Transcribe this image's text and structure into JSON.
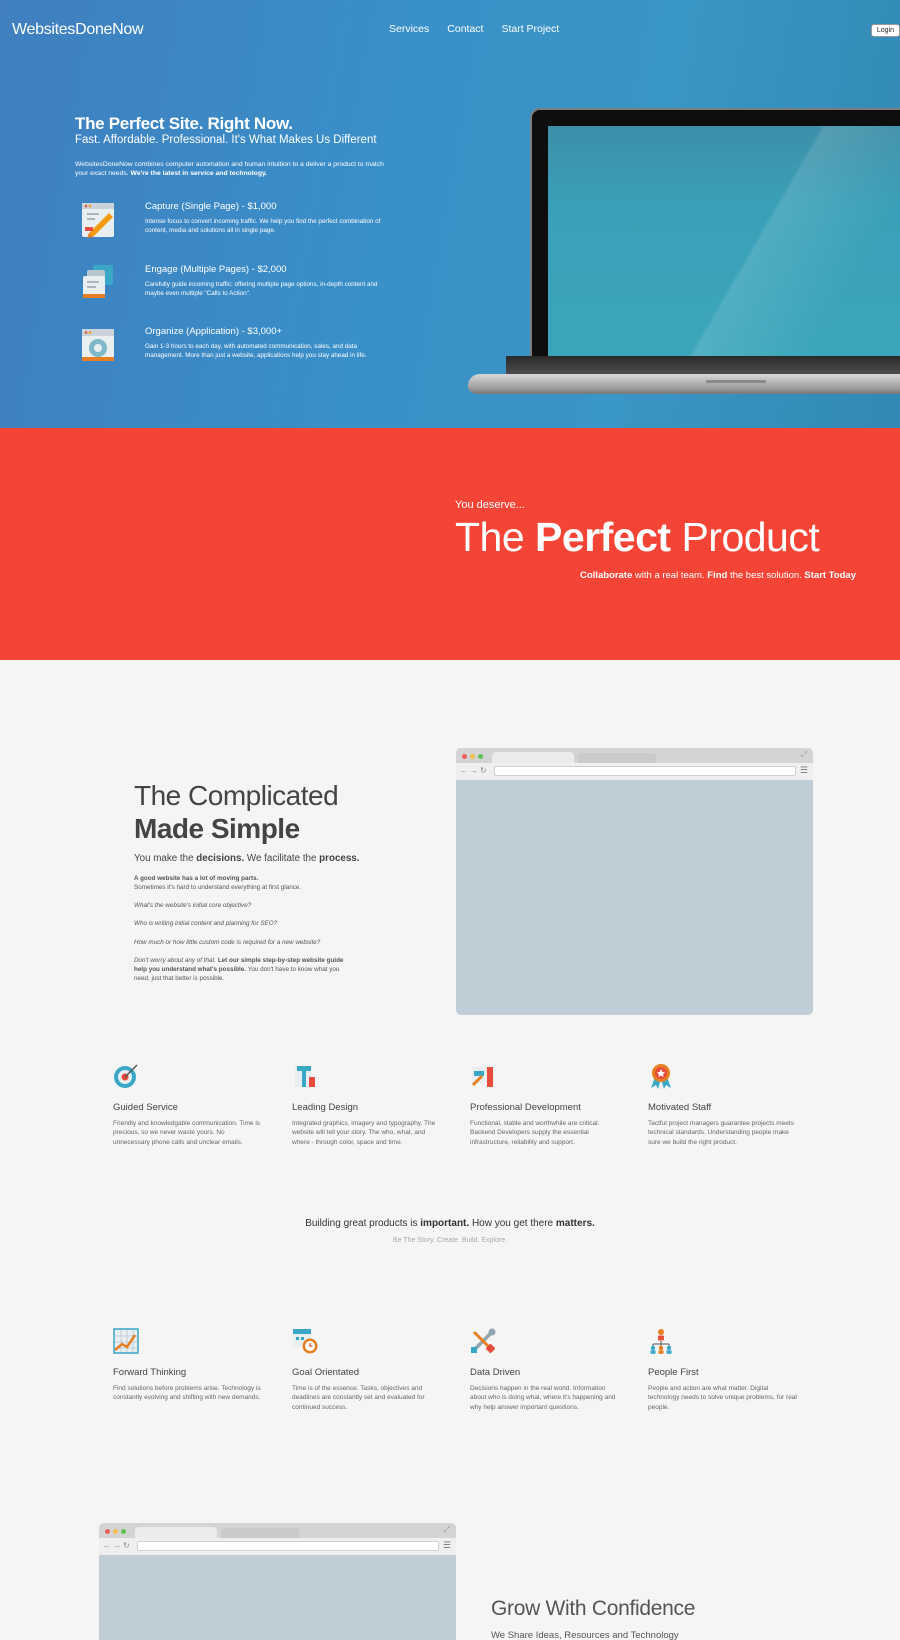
{
  "header": {
    "brand": "WebsitesDoneNow",
    "nav": [
      "Services",
      "Contact",
      "Start Project"
    ],
    "login": "Login"
  },
  "hero": {
    "title": "The Perfect Site. Right Now.",
    "subtitle": "Fast. Affordable. Professional. It's What Makes Us Different",
    "intro": "WebsitesDoneNow combines computer automation and human intuition to a deliver a product to match your exact needs.",
    "intro_bold": "We're the latest in service and technology.",
    "services": [
      {
        "title": "Capture (Single Page) - $1,000",
        "icon": "pencil-page-icon",
        "desc": "Intense focus to convert incoming traffic. We help you find the perfect combination of content, media and solutions all in single page."
      },
      {
        "title": "Engage (Multiple Pages) - $2,000",
        "icon": "multi-page-icon",
        "desc": "Carefully guide incoming traffic: offering multiple page options, in-depth content and maybe even multiple \"Calls to Action\"."
      },
      {
        "title": "Organize (Application) - $3,000+",
        "icon": "app-gear-icon",
        "desc": "Gain 1-3 hours to each day, with automated communication, sales, and data management. More than just a website, applications help you stay ahead in life."
      }
    ]
  },
  "banner": {
    "kicker": "You deserve...",
    "headline_pre": "The ",
    "headline_bold": "Perfect",
    "headline_post": " Product",
    "tag_b1": "Collaborate",
    "tag_t1": " with a real team. ",
    "tag_b2": "Find",
    "tag_t2": " the best solution. ",
    "tag_b3": "Start Today"
  },
  "complicated": {
    "line1": "The Complicated",
    "line2": "Made Simple",
    "lead_t1": "You make the ",
    "lead_b1": "decisions.",
    "lead_t2": " We facilitate the ",
    "lead_b2": "process.",
    "p1_bold": "A good website has a lot of moving parts.",
    "p1": "Sometimes it's hard to understand everything at first glance.",
    "q1": "What's the website's initial core objective?",
    "q2": "Who is writing initial content and planning for SEO?",
    "q3": "How much or how little custom code is required for a new website?",
    "p_end_i": "Don't worry about any of that.",
    "p_end_b": "Let our simple step-by-step website guide help you understand what's possible.",
    "p_end": "You don't have to know what you need, just that better is possible."
  },
  "features_a": [
    {
      "title": "Guided Service",
      "icon": "target-icon",
      "desc": "Friendly and knowledgable communication. Time is precious, so we never waste yours. No unnecessary phone calls and unclear emails."
    },
    {
      "title": "Leading Design",
      "icon": "typography-icon",
      "desc": "Integrated graphics, imagery and typography. The website will tell your story. The who, what, and where - through color, space and time."
    },
    {
      "title": "Professional Development",
      "icon": "tools-chart-icon",
      "desc": "Functional, stable and worthwhile are critical. Backend Developers supply the essential infrastructure, reliability and support."
    },
    {
      "title": "Motivated Staff",
      "icon": "award-ribbon-icon",
      "desc": "Tactful project managers guarantee projects meets technical standards. Understanding people make sure we build the right product."
    }
  ],
  "middle": {
    "q_t1": "Building great products is ",
    "q_b1": "important.",
    "q_t2": " How you get there ",
    "q_b2": "matters.",
    "sub": "Be The Story. Create. Build. Explore."
  },
  "features_b": [
    {
      "title": "Forward Thinking",
      "icon": "growth-chart-icon",
      "desc": "Find solutions before problems arise. Technology is constantly evolving and shifting with new demands."
    },
    {
      "title": "Goal Orientated",
      "icon": "calendar-clock-icon",
      "desc": "Time is of the essence. Tasks, objectives and deadlines are constantly set and evaluated for continued success."
    },
    {
      "title": "Data Driven",
      "icon": "wrench-screwdriver-icon",
      "desc": "Decisions happen in the real world. Information about who is doing what, where it's happening and why help answer important questions."
    },
    {
      "title": "People First",
      "icon": "people-network-icon",
      "desc": "People and action are what matter. Digital technology needs to solve unique problems, for real people."
    }
  ],
  "grow": {
    "title": "Grow With Confidence",
    "subtitle": "We Share Ideas, Resources and Technology"
  },
  "colors": {
    "hero_blue": "#3a8fc8",
    "banner_red": "#f44436",
    "page_bg": "#f5f5f5",
    "browser_fill": "#bfcdd6"
  }
}
